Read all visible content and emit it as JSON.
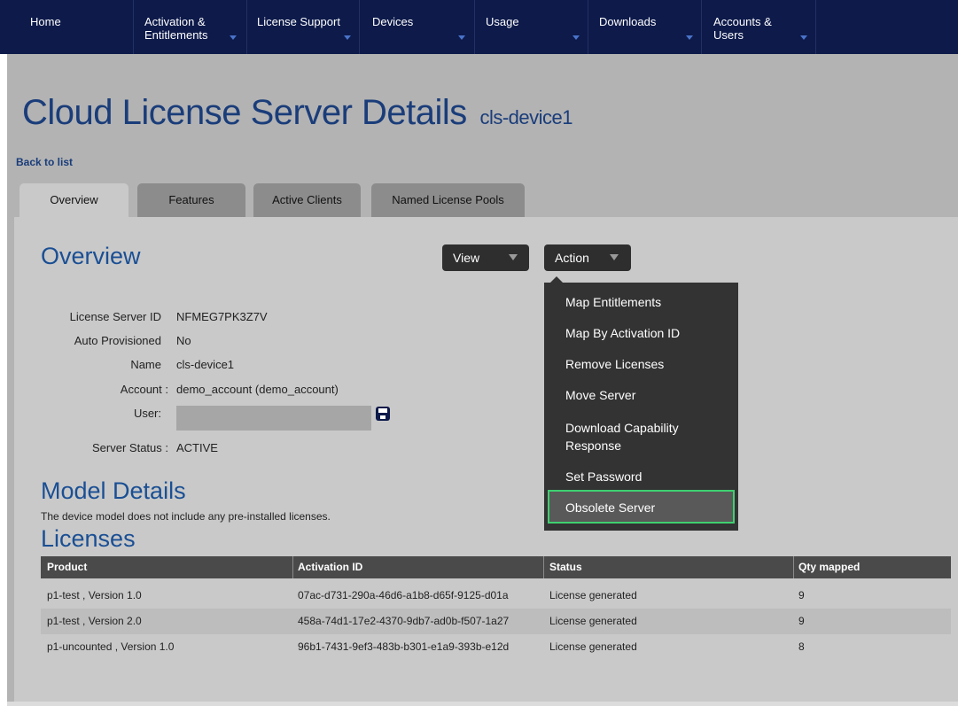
{
  "nav": {
    "items": [
      {
        "label": "Home",
        "dropdown": false
      },
      {
        "label": "Activation &\nEntitlements",
        "dropdown": true
      },
      {
        "label": "License Support",
        "dropdown": true
      },
      {
        "label": "Devices",
        "dropdown": true
      },
      {
        "label": "Usage",
        "dropdown": true
      },
      {
        "label": "Downloads",
        "dropdown": true
      },
      {
        "label": "Accounts &\nUsers",
        "dropdown": true
      }
    ]
  },
  "page": {
    "title": "Cloud License Server Details",
    "subtitle": "cls-device1",
    "back_link": "Back to list"
  },
  "tabs": [
    {
      "label": "Overview",
      "active": true
    },
    {
      "label": "Features",
      "active": false
    },
    {
      "label": "Active Clients",
      "active": false
    },
    {
      "label": "Named License Pools",
      "active": false
    }
  ],
  "overview": {
    "heading": "Overview",
    "view_button": "View",
    "action_button": "Action",
    "fields": {
      "license_server_id_label": "License Server ID",
      "license_server_id": "NFMEG7PK3Z7V",
      "auto_provisioned_label": "Auto Provisioned",
      "auto_provisioned": "No",
      "name_label": "Name",
      "name": "cls-device1",
      "account_label": "Account :",
      "account": "demo_account (demo_account)",
      "user_label": "User:",
      "user_value": "",
      "server_status_label": "Server Status :",
      "server_status": "ACTIVE"
    }
  },
  "action_menu": {
    "items": [
      "Map Entitlements",
      "Map By Activation ID",
      "Remove Licenses",
      "Move Server",
      "Download Capability\nResponse",
      "Set Password",
      "Obsolete Server"
    ],
    "highlighted": "Obsolete Server",
    "highlight_color": "#3fd070"
  },
  "model_details": {
    "heading": "Model Details",
    "description": "The device model does not include any pre-installed licenses."
  },
  "licenses": {
    "heading": "Licenses",
    "columns": [
      "Product",
      "Activation ID",
      "Status",
      "Qty mapped"
    ],
    "rows": [
      [
        "p1-test , Version 1.0",
        "07ac-d731-290a-46d6-a1b8-d65f-9125-d01a",
        "License generated",
        "9"
      ],
      [
        "p1-test , Version 2.0",
        "458a-74d1-17e2-4370-9db7-ad0b-f507-1a27",
        "License generated",
        "9"
      ],
      [
        "p1-uncounted , Version 1.0",
        "96b1-7431-9ef3-483b-b301-e1a9-393b-e12d",
        "License generated",
        "8"
      ]
    ]
  },
  "colors": {
    "nav_bg": "#0d1a4a",
    "title_blue": "#1a3d7a",
    "page_bg": "#b3b3b3",
    "panel_bg": "#c9c9c9",
    "menu_bg": "#333333"
  }
}
